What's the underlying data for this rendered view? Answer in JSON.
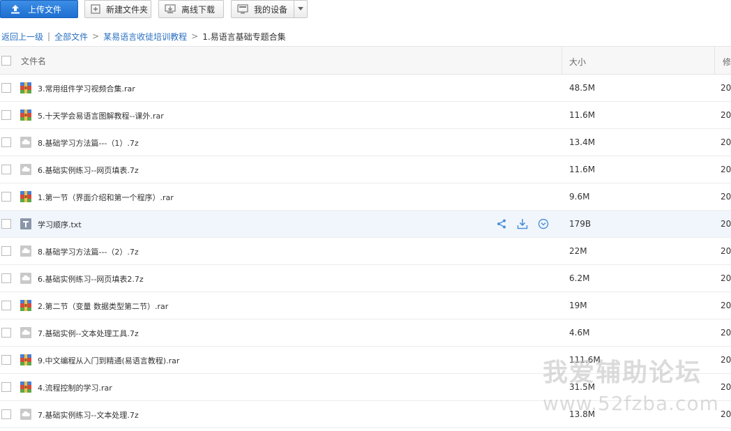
{
  "toolbar": {
    "upload_label": "上传文件",
    "new_folder_label": "新建文件夹",
    "offline_label": "离线下载",
    "device_label": "我的设备"
  },
  "breadcrumb": {
    "back": "返回上一级",
    "sep": "|",
    "all_files": "全部文件",
    "arrow": ">",
    "parent": "某易语言收徒培训教程",
    "current": "1.易语言基础专题合集"
  },
  "table": {
    "headers": {
      "name": "文件名",
      "size": "大小",
      "date": "修"
    },
    "rows": [
      {
        "type": "rar",
        "name": "3.常用组件学习视频合集.rar",
        "size": "48.5M",
        "date": "20"
      },
      {
        "type": "rar",
        "name": "5.十天学会易语言图解教程--课外.rar",
        "size": "11.6M",
        "date": "20"
      },
      {
        "type": "7z",
        "name": "8.基础学习方法篇---（1）.7z",
        "size": "13.4M",
        "date": "20"
      },
      {
        "type": "7z",
        "name": "6.基础实例练习--网页填表.7z",
        "size": "11.6M",
        "date": "20"
      },
      {
        "type": "rar",
        "name": "1.第一节（界面介绍和第一个程序）.rar",
        "size": "9.6M",
        "date": "20"
      },
      {
        "type": "txt",
        "name": "学习顺序.txt",
        "size": "179B",
        "date": "20",
        "hover": true
      },
      {
        "type": "7z",
        "name": "8.基础学习方法篇---（2）.7z",
        "size": "22M",
        "date": "20"
      },
      {
        "type": "7z",
        "name": "6.基础实例练习--网页填表2.7z",
        "size": "6.2M",
        "date": "20"
      },
      {
        "type": "rar",
        "name": "2.第二节（变量 数据类型第二节）.rar",
        "size": "19M",
        "date": "20"
      },
      {
        "type": "7z",
        "name": "7.基础实例--文本处理工具.7z",
        "size": "4.6M",
        "date": "20"
      },
      {
        "type": "rar",
        "name": "9.中文编程从入门到精通(易语言教程).rar",
        "size": "111.6M",
        "date": "20"
      },
      {
        "type": "rar",
        "name": "4.流程控制的学习.rar",
        "size": "31.5M",
        "date": "20"
      },
      {
        "type": "7z",
        "name": "7.基础实例练习--文本处理.7z",
        "size": "13.8M",
        "date": "20"
      }
    ]
  },
  "watermark": {
    "line1": "我爱辅助论坛",
    "line2": "www.52fzba.com"
  },
  "colors": {
    "accent": "#1d6fd1",
    "link": "#2a6fc0",
    "hover_row": "#f1f6fd",
    "action_icon": "#4a90d9"
  }
}
